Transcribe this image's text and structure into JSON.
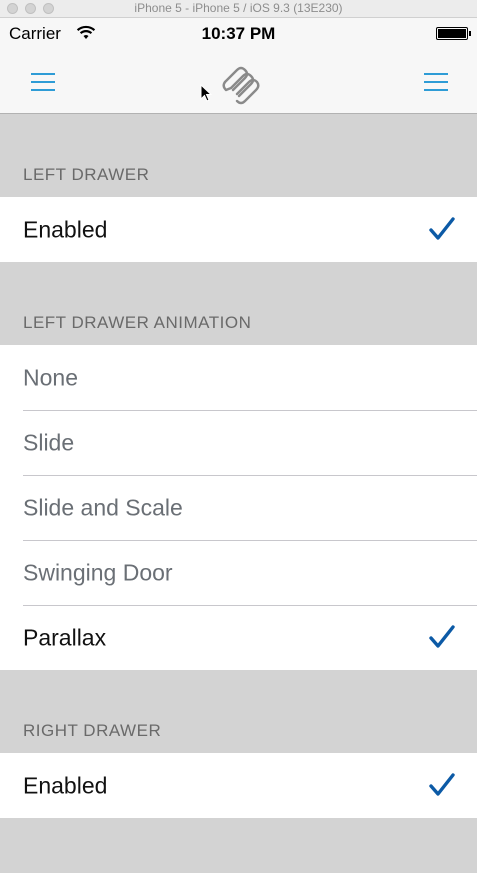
{
  "window": {
    "title": "iPhone 5 - iPhone 5 / iOS 9.3 (13E230)"
  },
  "status_bar": {
    "carrier": "Carrier",
    "time": "10:37 PM"
  },
  "colors": {
    "accent": "#2e9cd6",
    "checkmark": "#0c5aa6",
    "background": "#d3d3d3"
  },
  "sections": {
    "left_drawer": {
      "header": "LEFT DRAWER",
      "rows": [
        {
          "label": "Enabled",
          "checked": true
        }
      ]
    },
    "left_drawer_animation": {
      "header": "LEFT DRAWER ANIMATION",
      "rows": [
        {
          "label": "None",
          "checked": false
        },
        {
          "label": "Slide",
          "checked": false
        },
        {
          "label": "Slide and Scale",
          "checked": false
        },
        {
          "label": "Swinging Door",
          "checked": false
        },
        {
          "label": "Parallax",
          "checked": true
        }
      ]
    },
    "right_drawer": {
      "header": "RIGHT DRAWER",
      "rows": [
        {
          "label": "Enabled",
          "checked": true
        }
      ]
    }
  }
}
